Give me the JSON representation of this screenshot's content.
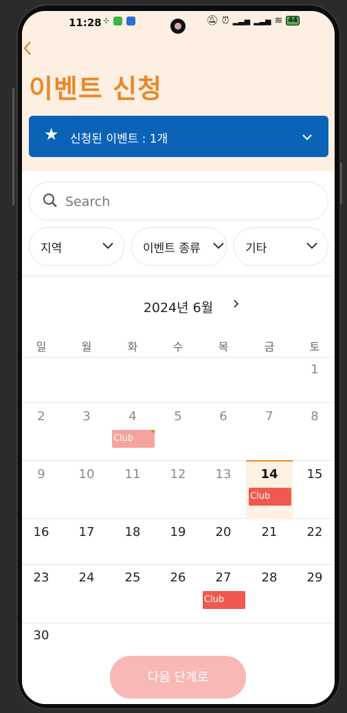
{
  "status": {
    "time": "11:28",
    "battery": "44"
  },
  "header": {
    "back_icon": "chevron-left-icon",
    "title": "이벤트 신청"
  },
  "banner": {
    "icon": "star-icon",
    "text": "신청된 이벤트 : 1개",
    "color": "#0b63b8"
  },
  "search": {
    "placeholder": "Search"
  },
  "filters": [
    {
      "label": "지역"
    },
    {
      "label": "이벤트 종류"
    },
    {
      "label": "기타"
    }
  ],
  "calendar": {
    "month_label": "2024년 6월",
    "weekdays": [
      "일",
      "월",
      "화",
      "수",
      "목",
      "금",
      "토"
    ],
    "weeks": [
      [
        "",
        "",
        "",
        "",
        "",
        "",
        "1"
      ],
      [
        "2",
        "3",
        "4",
        "5",
        "6",
        "7",
        "8"
      ],
      [
        "9",
        "10",
        "11",
        "12",
        "13",
        "14",
        "15"
      ],
      [
        "16",
        "17",
        "18",
        "19",
        "20",
        "21",
        "22"
      ],
      [
        "23",
        "24",
        "25",
        "26",
        "27",
        "28",
        "29"
      ],
      [
        "30",
        "",
        "",
        "",
        "",
        "",
        ""
      ]
    ],
    "today": "14",
    "events": [
      {
        "day": "4",
        "label": "Club",
        "style": "past"
      },
      {
        "day": "14",
        "label": "Club",
        "style": "active"
      },
      {
        "day": "27",
        "label": "Club",
        "style": "active"
      }
    ]
  },
  "footer": {
    "next_label": "다음 단계로"
  },
  "colors": {
    "accent": "#e8882a",
    "event_active": "#f0594f",
    "event_past": "#f6a3a0",
    "next_button": "#f7b8b6"
  }
}
